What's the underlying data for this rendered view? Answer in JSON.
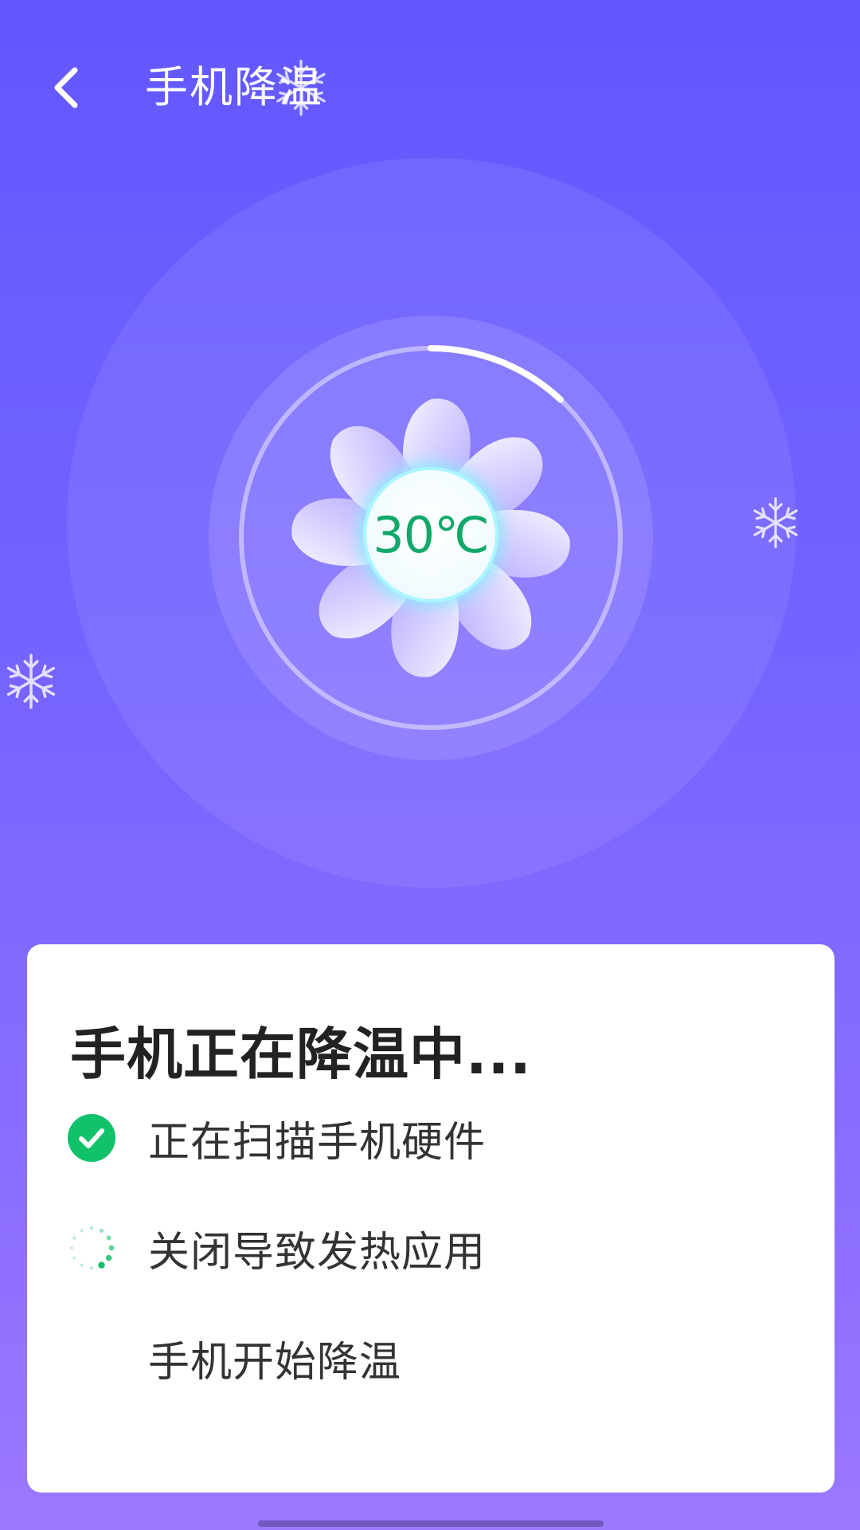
{
  "header": {
    "back_icon": "chevron-left-icon",
    "title": "手机降温"
  },
  "fan": {
    "temperature": "30℃",
    "progress": 0.12
  },
  "card": {
    "title": "手机正在降温中...",
    "steps": [
      {
        "label": "正在扫描手机硬件",
        "status": "done",
        "icon": "check-circle-icon"
      },
      {
        "label": "关闭导致发热应用",
        "status": "in-progress",
        "icon": "loading-spinner-icon"
      },
      {
        "label": "手机开始降温",
        "status": "pending",
        "icon": ""
      }
    ]
  },
  "colors": {
    "background_top": "#6257FF",
    "background_bottom": "#9B78FF",
    "accent_green": "#12C26B",
    "temperature_text": "#12A869"
  }
}
